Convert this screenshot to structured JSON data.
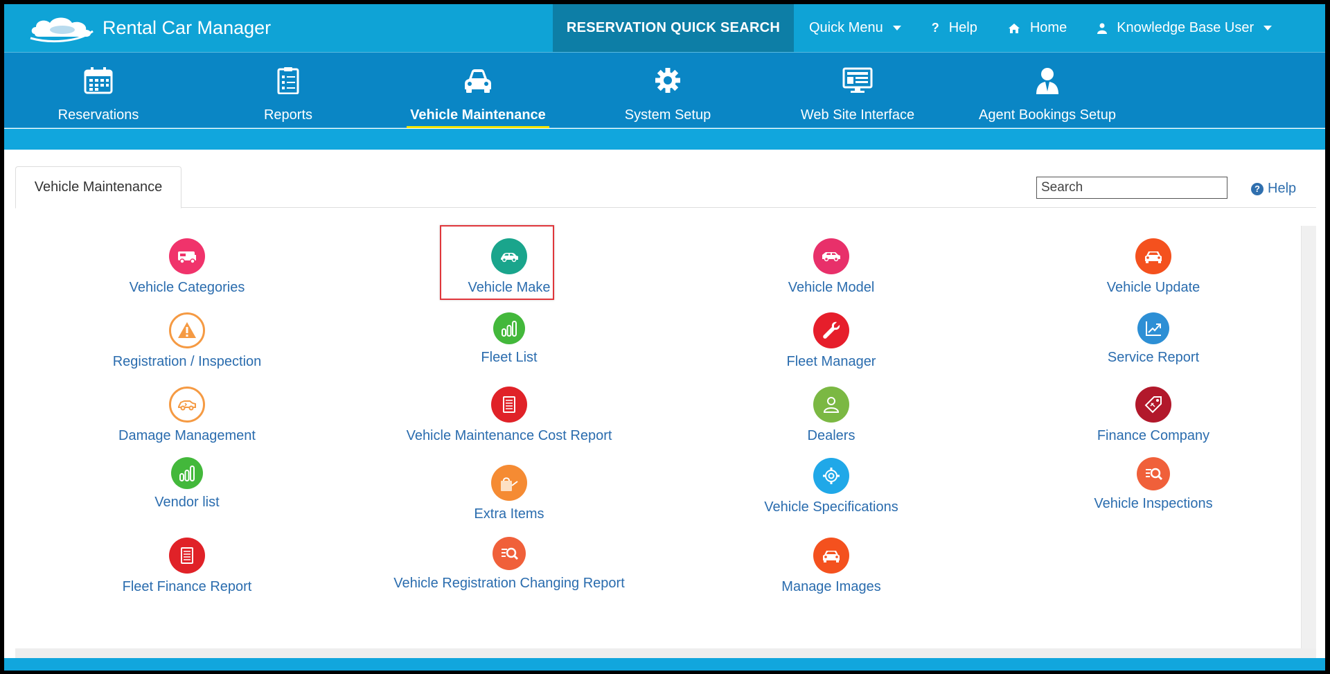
{
  "app": {
    "title": "Rental Car Manager"
  },
  "topbar": {
    "quick_search": "RESERVATION QUICK SEARCH",
    "quick_menu": "Quick Menu",
    "help": "Help",
    "home": "Home",
    "user": "Knowledge Base User"
  },
  "modules": [
    {
      "label": "Reservations",
      "icon": "calendar-icon"
    },
    {
      "label": "Reports",
      "icon": "clipboard-checklist-icon"
    },
    {
      "label": "Vehicle Maintenance",
      "icon": "car-icon",
      "active": true
    },
    {
      "label": "System Setup",
      "icon": "gear-icon"
    },
    {
      "label": "Web Site Interface",
      "icon": "monitor-icon"
    },
    {
      "label": "Agent Bookings Setup",
      "icon": "agent-icon"
    }
  ],
  "tab": {
    "label": "Vehicle Maintenance"
  },
  "search": {
    "placeholder": "Search"
  },
  "help_link": "Help",
  "items": [
    {
      "label": "Vehicle Categories",
      "icon": "rv-camper-icon",
      "color": "#f0336b"
    },
    {
      "label": "Vehicle Make",
      "icon": "car-icon",
      "color": "#1aa58c",
      "highlighted": true
    },
    {
      "label": "Vehicle Model",
      "icon": "suv-icon",
      "color": "#e8306a"
    },
    {
      "label": "Vehicle Update",
      "icon": "car-front-icon",
      "color": "#f4511e"
    },
    {
      "label": "Registration / Inspection",
      "icon": "warning-icon",
      "color": "#f59a43"
    },
    {
      "label": "Fleet List",
      "icon": "bar-chart-icon",
      "color": "#43b83b"
    },
    {
      "label": "Fleet Manager",
      "icon": "wrench-icon",
      "color": "#e61e2b"
    },
    {
      "label": "Service Report",
      "icon": "trend-chart-icon",
      "color": "#2d8fd5"
    },
    {
      "label": "Damage Management",
      "icon": "damaged-car-icon",
      "color": "#f59a43"
    },
    {
      "label": "Vehicle Maintenance Cost Report",
      "icon": "document-icon",
      "color": "#e02228"
    },
    {
      "label": "Dealers",
      "icon": "person-icon",
      "color": "#7bb843"
    },
    {
      "label": "Finance Company",
      "icon": "price-tag-icon",
      "color": "#b2182b"
    },
    {
      "label": "Vendor list",
      "icon": "bar-chart-icon",
      "color": "#43b83b"
    },
    {
      "label": "Extra Items",
      "icon": "shopping-bag-icon",
      "color": "#f58b33"
    },
    {
      "label": "Vehicle Specifications",
      "icon": "settings-icon",
      "color": "#20a8e8"
    },
    {
      "label": "Vehicle Inspections",
      "icon": "search-list-icon",
      "color": "#f0603a"
    },
    {
      "label": "Fleet Finance Report",
      "icon": "document-icon",
      "color": "#e02228"
    },
    {
      "label": "Vehicle Registration Changing Report",
      "icon": "search-list-icon",
      "color": "#f0603a"
    },
    {
      "label": "Manage Images",
      "icon": "car-front-icon",
      "color": "#f4511e"
    }
  ]
}
